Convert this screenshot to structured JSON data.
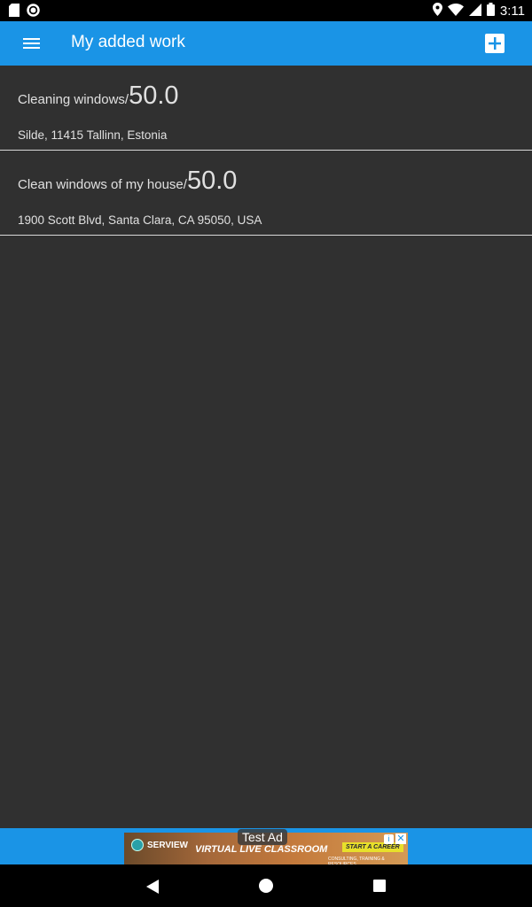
{
  "status_bar": {
    "time": "3:11",
    "icons": [
      "sd-card-icon",
      "circle-notification-icon",
      "location-icon",
      "wifi-icon",
      "signal-icon",
      "battery-icon"
    ]
  },
  "app_bar": {
    "title": "My added work",
    "menu_icon": "hamburger-menu-icon",
    "add_icon": "add-box-icon"
  },
  "work_items": [
    {
      "name": "Cleaning windows/",
      "price": "50.0",
      "address": "Silde, 11415 Tallinn, Estonia"
    },
    {
      "name": "Clean windows of my house/",
      "price": "50.0",
      "address": "1900 Scott Blvd, Santa Clara, CA 95050, USA"
    }
  ],
  "ad": {
    "label": "Test Ad",
    "brand": "SERVIEW",
    "headline": "VIRTUAL LIVE CLASSROOM",
    "cta": "START A CAREER",
    "subtext": "CONSULTING, TRAINING & RESOURCES"
  },
  "colors": {
    "accent": "#1a94e6",
    "background": "#303030",
    "divider": "#d8d8d8"
  }
}
